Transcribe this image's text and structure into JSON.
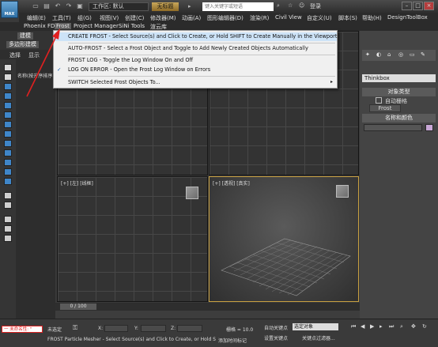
{
  "app": {
    "workspace": "工作区: 默认",
    "doc_title": "无标题",
    "search_placeholder": "键入关键字或短语",
    "login": "登录"
  },
  "menu_row1": [
    "编辑(E)",
    "工具(T)",
    "组(G)",
    "视图(V)",
    "创建(C)",
    "修改器(M)",
    "动画(A)",
    "图形编辑器(D)",
    "渲染(R)",
    "Civil View",
    "自定义(U)",
    "脚本(S)",
    "帮助(H)",
    "DesignToolBox"
  ],
  "menu_row2": [
    "Phoenix FD",
    "Frost",
    "Project Manager",
    "SiNi Tools",
    "渲云库"
  ],
  "ribbon": {
    "tab_a": "建模",
    "tab_b": "多边形建模",
    "sel_label": "选择",
    "show_label": "显示",
    "left_panel_text": "名称(按升序排序)"
  },
  "frost_menu": [
    "CREATE FROST - Select Source(s) and Click to Create, or Hold SHIFT to Create Manually in the Viewport",
    "AUTO-FROST - Select a Frost Object and Toggle to Add Newly Created Objects Automatically",
    "FROST LOG - Toggle the Log Window On and Off",
    "LOG ON ERROR - Open the Frost Log Window on Errors",
    "SWITCH Selected Frost Objects To..."
  ],
  "viewports": {
    "bottom_left": "[+] [左] [线框]",
    "bottom_right": "[+] [透视] [真实]"
  },
  "right_panel": {
    "renderer": "Thinkbox",
    "object_type": "对象类型",
    "auto_grid": "自动栅格",
    "frost_button": "Frost",
    "name_color": "名称和颜色"
  },
  "timeline": {
    "frame": "0 / 100"
  },
  "status": {
    "selected": "未选定",
    "x_label": "X:",
    "y_label": "Y:",
    "z_label": "Z:",
    "grid": "栅格 = 10.0",
    "auto_key": "自动关键点",
    "selected_obj": "选定对象",
    "set_key": "设置关键点",
    "key_filter": "关键点过滤器...",
    "add_time_tag": "添加时间标记",
    "prompt": "FROST Particle Mesher - Select Source(s) and Click to Create, or Hold S",
    "warning": "一 未命名性: \""
  }
}
